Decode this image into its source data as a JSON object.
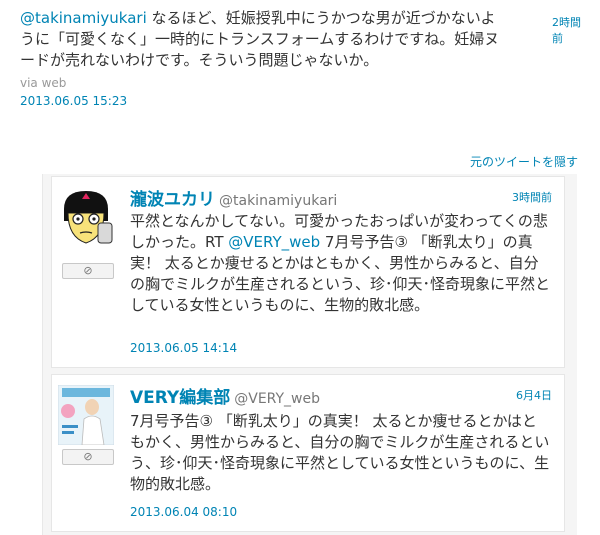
{
  "main_tweet": {
    "mention": "@takinamiyukari",
    "text": " なるほど、妊娠授乳中にうかつな男が近づかないように「可愛くなく」一時的にトランスフォームするわけですね。妊婦ヌードが売れないわけです。そういう問題じゃないか。",
    "relative_time": "2時間前",
    "via": "via web",
    "datetime": "2013.06.05 15:23"
  },
  "hide_link": "元のツイートを隠す",
  "tweets": [
    {
      "name": "瀧波ユカリ",
      "screen_name": "@takinamiyukari",
      "relative_time": "3時間前",
      "text_before": "平然となんかしてない。可愛かったおっぱいが変わってくの悲しかった。RT ",
      "mention": "@VERY_web",
      "text_after": " 7月号予告③ 「断乳太り」の真実！ 太るとか痩せるとかはともかく、男性からみると、自分の胸でミルクが生産されるという、珍･仰天･怪奇現象に平然としている女性というものに、生物的敗北感。",
      "datetime": "2013.06.05 14:14",
      "reply_icon": "⊘"
    },
    {
      "name": "VERY編集部",
      "screen_name": "@VERY_web",
      "relative_time": "6月4日",
      "text": "7月号予告③ 「断乳太り」の真実！ 太るとか痩せるとかはともかく、男性からみると、自分の胸でミルクが生産されるという、珍･仰天･怪奇現象に平然としている女性というものに、生物的敗北感。",
      "datetime": "2013.06.04 08:10",
      "reply_icon": "⊘"
    }
  ]
}
